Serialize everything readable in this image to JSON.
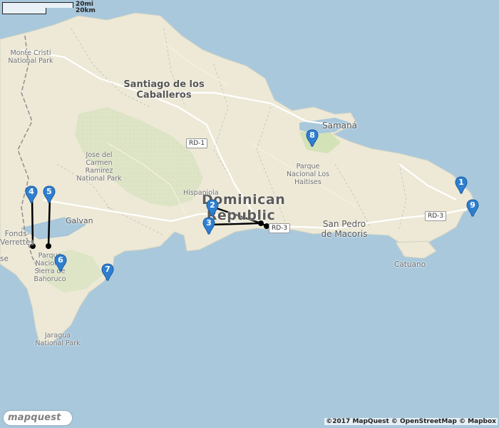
{
  "map": {
    "scale": {
      "imperial": "20mi",
      "metric": "20km"
    },
    "labels": {
      "country": "Dominican Republic",
      "city_santiago": "Santiago de los Caballeros",
      "city_samana": "Samaná",
      "city_san_pedro": "San Pedro de Macoris",
      "park_monte_cristi": "Monte Cristi National Park",
      "park_jose_del_carmen": "Jose del Carmen Ramirez National Park",
      "park_los_haitises": "Parque Nacional Los Haitises",
      "park_sierra_bahoruco": "Parque Nacional Sierra de Bahoruco",
      "park_jaragua": "Jaragua National Park",
      "island_hispaniola": "Hispaniola",
      "town_galvan": "Galvan",
      "town_catuano": "Catuano",
      "town_fonds_verrettes": "Fonds-Verrettes",
      "town_se": "se"
    },
    "roads": {
      "rd1": "RD-1",
      "rd3_west": "RD-3",
      "rd3_east": "RD-3"
    },
    "markers": [
      "1",
      "2",
      "3",
      "4",
      "5",
      "6",
      "7",
      "8",
      "9"
    ],
    "marker_color": "#2f7fd0",
    "route_color": "#000000",
    "land_color": "#ede9d6",
    "water_color": "#a9c8dc",
    "logo": "mapquest",
    "attribution": "©2017 MapQuest © OpenStreetMap © Mapbox"
  }
}
